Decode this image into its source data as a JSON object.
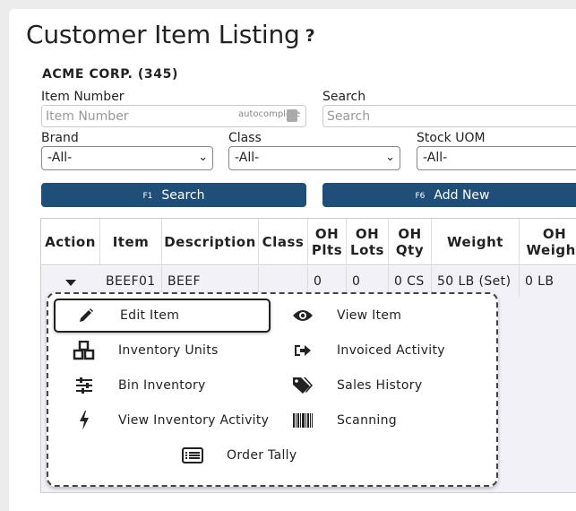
{
  "header": {
    "title": "Customer Item Listing",
    "help": "?"
  },
  "customer": {
    "name": "ACME CORP. (345)"
  },
  "filters": {
    "item_number_label": "Item Number",
    "item_number_placeholder": "Item Number",
    "autocomplete_hint": "autocomplete",
    "search_label": "Search",
    "search_placeholder": "Search",
    "brand_label": "Brand",
    "brand_value": "-All-",
    "class_label": "Class",
    "class_value": "-All-",
    "stock_uom_label": "Stock UOM",
    "stock_uom_value": "-All-"
  },
  "buttons": {
    "search_key": "F1",
    "search_label": "Search",
    "add_key": "F6",
    "add_label": "Add New"
  },
  "table": {
    "headers": [
      "Action",
      "Item",
      "Description",
      "Class",
      "OH Plts",
      "OH Lots",
      "OH Qty",
      "Weight",
      "OH Weight"
    ],
    "row": {
      "item": "BEEF01",
      "description": "BEEF",
      "class": "",
      "oh_plts": "0",
      "oh_lots": "0",
      "oh_qty": "0 CS",
      "weight": "50 LB (Set)",
      "oh_weight": "0 LB"
    }
  },
  "menu": {
    "items": [
      {
        "label": "Edit Item",
        "icon": "pencil-icon"
      },
      {
        "label": "View Item",
        "icon": "eye-icon"
      },
      {
        "label": "Inventory Units",
        "icon": "cubes-icon"
      },
      {
        "label": "Invoiced Activity",
        "icon": "sign-out-icon"
      },
      {
        "label": "Bin Inventory",
        "icon": "sliders-icon"
      },
      {
        "label": "Sales History",
        "icon": "tags-icon"
      },
      {
        "label": "View Inventory Activity",
        "icon": "bolt-icon"
      },
      {
        "label": "Scanning",
        "icon": "barcode-icon"
      },
      {
        "label": "Order Tally",
        "icon": "list-alt-icon"
      }
    ]
  },
  "colors": {
    "button_bg": "#1f4e79",
    "row_bg": "#f1f1f7"
  }
}
